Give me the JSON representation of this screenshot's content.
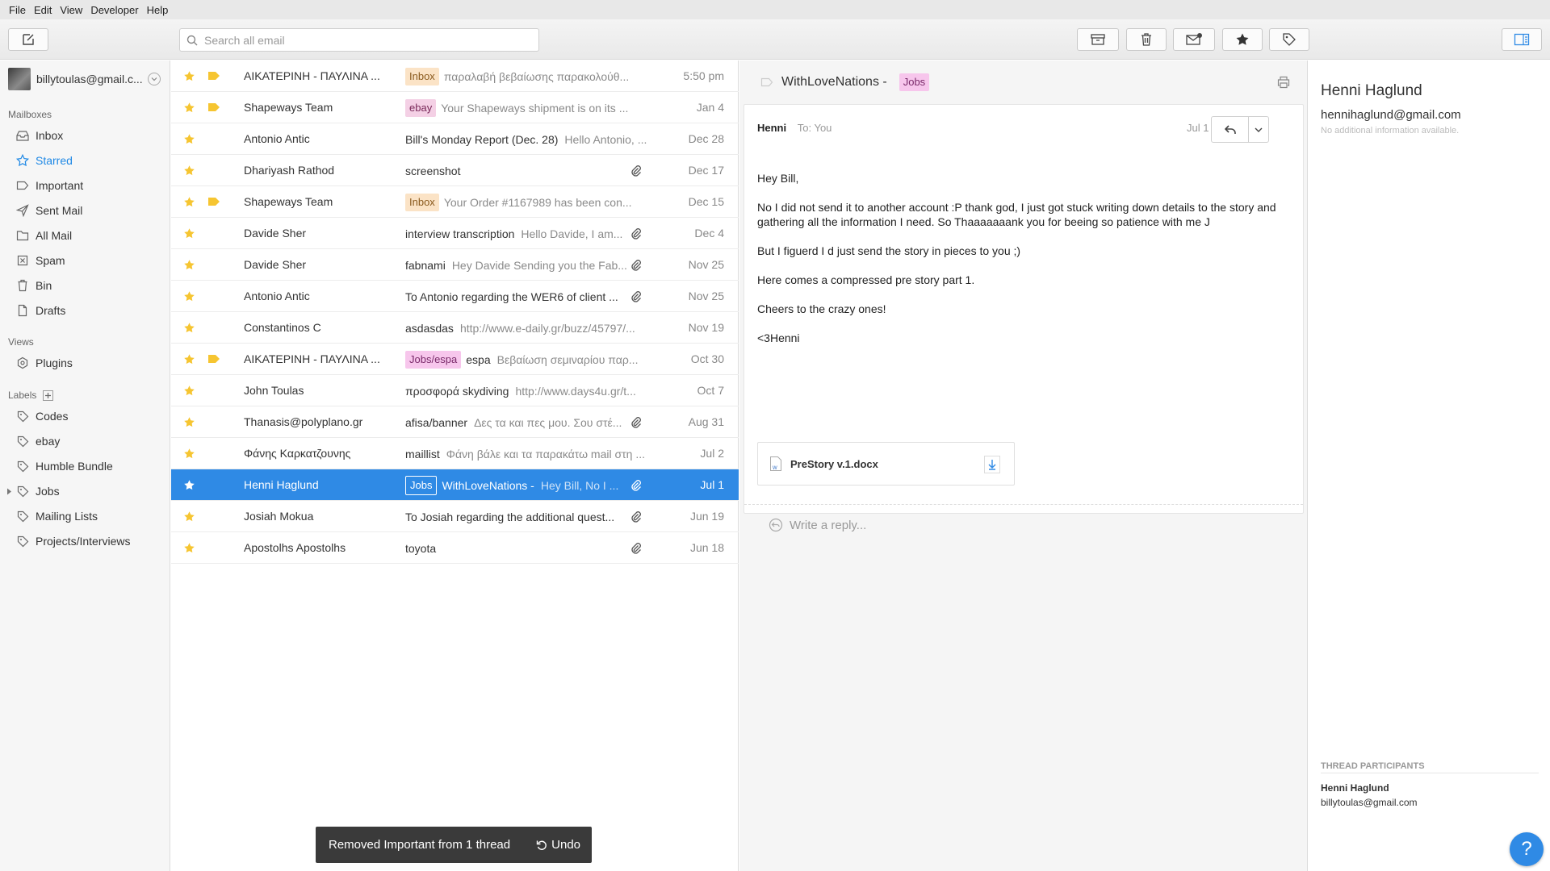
{
  "menu": [
    "File",
    "Edit",
    "View",
    "Developer",
    "Help"
  ],
  "search": {
    "placeholder": "Search all email"
  },
  "account": {
    "email": "billytoulas@gmail.c..."
  },
  "sidebar": {
    "mailboxes_label": "Mailboxes",
    "mailboxes": [
      {
        "label": "Inbox",
        "icon": "inbox-icon"
      },
      {
        "label": "Starred",
        "icon": "star-icon"
      },
      {
        "label": "Important",
        "icon": "important-icon"
      },
      {
        "label": "Sent Mail",
        "icon": "send-icon"
      },
      {
        "label": "All Mail",
        "icon": "folder-icon"
      },
      {
        "label": "Spam",
        "icon": "spam-icon"
      },
      {
        "label": "Bin",
        "icon": "trash-icon"
      },
      {
        "label": "Drafts",
        "icon": "draft-icon"
      }
    ],
    "views_label": "Views",
    "views": [
      {
        "label": "Plugins",
        "icon": "plugin-icon"
      }
    ],
    "labels_label": "Labels",
    "labels": [
      {
        "label": "Codes"
      },
      {
        "label": "ebay"
      },
      {
        "label": "Humble Bundle"
      },
      {
        "label": "Jobs"
      },
      {
        "label": "Mailing Lists"
      },
      {
        "label": "Projects/Interviews"
      }
    ]
  },
  "threads": [
    {
      "sender": "ΑΙΚΑΤΕΡΙΝΗ - ΠΑΥΛΙΝΑ ...",
      "tag": "Inbox",
      "tag_type": "inbox",
      "subject": "",
      "snippet": "παραλαβή βεβαίωσης παρακολούθ...",
      "date": "5:50 pm",
      "label_icon": true,
      "clip": false
    },
    {
      "sender": "Shapeways Team",
      "tag": "ebay",
      "tag_type": "ebay",
      "subject": "",
      "snippet": "Your Shapeways shipment is on its ...",
      "date": "Jan 4",
      "label_icon": true,
      "clip": false
    },
    {
      "sender": "Antonio Antic",
      "tag": "",
      "tag_type": "",
      "subject": "Bill's Monday Report (Dec. 28)",
      "snippet": "Hello Antonio, ...",
      "date": "Dec 28",
      "label_icon": false,
      "clip": false
    },
    {
      "sender": "Dhariyash Rathod",
      "tag": "",
      "tag_type": "",
      "subject": "screenshot",
      "snippet": "",
      "date": "Dec 17",
      "label_icon": false,
      "clip": true
    },
    {
      "sender": "Shapeways Team",
      "tag": "Inbox",
      "tag_type": "inbox",
      "subject": "",
      "snippet": "Your Order #1167989 has been con...",
      "date": "Dec 15",
      "label_icon": true,
      "clip": false
    },
    {
      "sender": "Davide Sher",
      "tag": "",
      "tag_type": "",
      "subject": "interview transcription",
      "snippet": "Hello Davide, I am...",
      "date": "Dec 4",
      "label_icon": false,
      "clip": true
    },
    {
      "sender": "Davide Sher",
      "tag": "",
      "tag_type": "",
      "subject": "fabnami",
      "snippet": "Hey Davide Sending you the Fab...",
      "date": "Nov 25",
      "label_icon": false,
      "clip": true
    },
    {
      "sender": "Antonio Antic",
      "tag": "",
      "tag_type": "",
      "subject": "To Antonio regarding the WER6 of client ...",
      "snippet": "",
      "date": "Nov 25",
      "label_icon": false,
      "clip": true
    },
    {
      "sender": "Constantinos C",
      "tag": "",
      "tag_type": "",
      "subject": "asdasdas",
      "snippet": "http://www.e-daily.gr/buzz/45797/...",
      "date": "Nov 19",
      "label_icon": false,
      "clip": false
    },
    {
      "sender": "ΑΙΚΑΤΕΡΙΝΗ - ΠΑΥΛΙΝΑ ...",
      "tag": "Jobs/espa",
      "tag_type": "jobs",
      "subject": "espa",
      "snippet": "Βεβαίωση σεμιναρίου παρ...",
      "date": "Oct 30",
      "label_icon": true,
      "clip": false
    },
    {
      "sender": "John Toulas",
      "tag": "",
      "tag_type": "",
      "subject": "προσφορά skydiving",
      "snippet": "http://www.days4u.gr/t...",
      "date": "Oct 7",
      "label_icon": false,
      "clip": false
    },
    {
      "sender": "Thanasis@polyplano.gr",
      "tag": "",
      "tag_type": "",
      "subject": "afisa/banner",
      "snippet": "Δες τα και πες μου. Σου στέ...",
      "date": "Aug 31",
      "label_icon": false,
      "clip": true
    },
    {
      "sender": "Φάνης Καρκατζουνης",
      "tag": "",
      "tag_type": "",
      "subject": "maillist",
      "snippet": "Φάνη βάλε και τα παρακάτω mail στη ...",
      "date": "Jul 2",
      "label_icon": false,
      "clip": false
    },
    {
      "sender": "Henni Haglund",
      "tag": "Jobs",
      "tag_type": "jobs",
      "subject": "WithLoveNations -",
      "snippet": "Hey Bill, No I ...",
      "date": "Jul 1",
      "label_icon": false,
      "clip": true,
      "selected": true
    },
    {
      "sender": "Josiah Mokua",
      "tag": "",
      "tag_type": "",
      "subject": "To Josiah regarding the additional quest...",
      "snippet": "",
      "date": "Jun 19",
      "label_icon": false,
      "clip": true
    },
    {
      "sender": "Apostolhs Apostolhs",
      "tag": "",
      "tag_type": "",
      "subject": "toyota",
      "snippet": "",
      "date": "Jun 18",
      "label_icon": false,
      "clip": true
    }
  ],
  "toast": {
    "message": "Removed Important from 1 thread",
    "undo": "Undo"
  },
  "message": {
    "subject": "WithLoveNations -",
    "tag": "Jobs",
    "from": "Henni",
    "to": "To: You",
    "date": "Jul 1",
    "body": [
      "Hey Bill,",
      "No I did not send it to another account :P thank god, I just got stuck writing down details to the story and gathering all the information I need. So Thaaaaaaank you for beeing so patience with me J",
      "But I figuerd I d just send the story in pieces to you ;)",
      "Here comes a compressed pre story part 1.",
      "Cheers to the crazy ones!",
      "<3Henni"
    ],
    "attachment": "PreStory v.1.docx",
    "reply_placeholder": "Write a reply..."
  },
  "contact": {
    "name": "Henni Haglund",
    "email": "hennihaglund@gmail.com",
    "info": "No additional information available.",
    "participants_label": "THREAD PARTICIPANTS",
    "participants": [
      {
        "name": "Henni Haglund",
        "email": "billytoulas@gmail.com"
      }
    ]
  },
  "help": "?",
  "colors": {
    "accent": "#2f8ae5",
    "star": "#f6c531",
    "inbox_tag": "#fbe3c6",
    "jobs_tag": "#f7c6ec",
    "ebay_tag": "#f4d0e5"
  }
}
